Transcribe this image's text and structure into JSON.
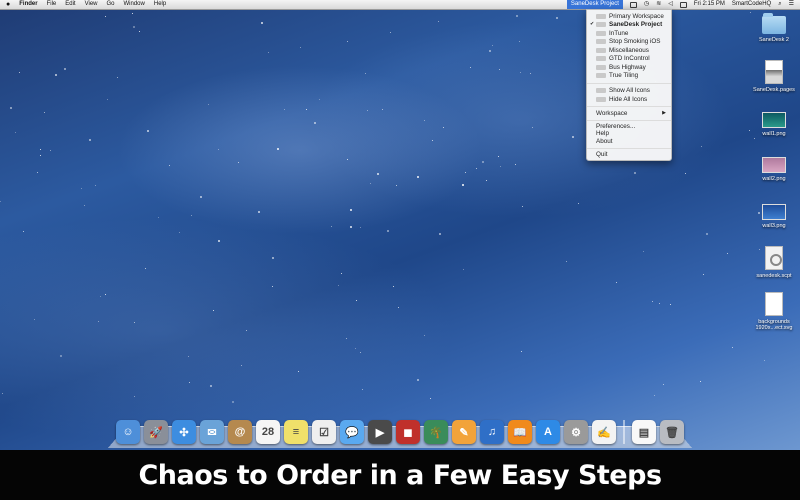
{
  "menubar": {
    "apple": "",
    "app_name": "Finder",
    "menus": [
      "File",
      "Edit",
      "View",
      "Go",
      "Window",
      "Help"
    ],
    "status_app": "SaneDesk Project",
    "clock": "Fri 2:15 PM",
    "user": "SmartCodeHQ"
  },
  "dropdown": {
    "workspaces": [
      "Primary Workspace",
      "SaneDesk Project",
      "InTune",
      "Stop Smoking iOS",
      "Miscellaneous",
      "GTD InControl",
      "Bus Highway",
      "True Tiling"
    ],
    "selected": "SaneDesk Project",
    "icon_actions": [
      "Show All Icons",
      "Hide All Icons"
    ],
    "workspace_submenu": "Workspace",
    "misc": [
      "Preferences...",
      "Help",
      "About"
    ],
    "quit": "Quit"
  },
  "desktop_icons": [
    {
      "label": "SaneDesk 2",
      "kind": "folder"
    },
    {
      "label": "SaneDesk.pages",
      "kind": "document"
    },
    {
      "label": "wall1.png",
      "kind": "image"
    },
    {
      "label": "wall2.png",
      "kind": "image"
    },
    {
      "label": "wall3.png",
      "kind": "image"
    },
    {
      "label": "sanedesk.scpt",
      "kind": "script"
    },
    {
      "label": "backgrounds 1920x...ect.svg",
      "kind": "document"
    }
  ],
  "dock_apps": [
    {
      "name": "finder-icon",
      "color": "#4e8fd9",
      "glyph": "☺"
    },
    {
      "name": "launchpad-icon",
      "color": "#8a8f99",
      "glyph": "🚀"
    },
    {
      "name": "safari-icon",
      "color": "#3d8de0",
      "glyph": "✣"
    },
    {
      "name": "mail-icon",
      "color": "#6aa3d8",
      "glyph": "✉"
    },
    {
      "name": "contacts-icon",
      "color": "#b5894f",
      "glyph": "@"
    },
    {
      "name": "calendar-icon",
      "color": "#f5f5f5",
      "glyph": "28"
    },
    {
      "name": "notes-icon",
      "color": "#f0e06a",
      "glyph": "≡"
    },
    {
      "name": "reminders-icon",
      "color": "#efefef",
      "glyph": "☑"
    },
    {
      "name": "messages-icon",
      "color": "#5aa9f0",
      "glyph": "💬"
    },
    {
      "name": "facetime-icon",
      "color": "#4a4a4a",
      "glyph": "▶"
    },
    {
      "name": "photo-booth-icon",
      "color": "#c0302b",
      "glyph": "◼"
    },
    {
      "name": "iphoto-icon",
      "color": "#3a8c5a",
      "glyph": "🌴"
    },
    {
      "name": "pages-icon",
      "color": "#f2a33a",
      "glyph": "✎"
    },
    {
      "name": "itunes-icon",
      "color": "#2f6fc7",
      "glyph": "♫"
    },
    {
      "name": "ibooks-icon",
      "color": "#f08a1c",
      "glyph": "📖"
    },
    {
      "name": "app-store-icon",
      "color": "#2e8ae6",
      "glyph": "A"
    },
    {
      "name": "system-preferences-icon",
      "color": "#9a9a9a",
      "glyph": "⚙"
    },
    {
      "name": "textedit-icon",
      "color": "#f3f3f3",
      "glyph": "✍"
    }
  ],
  "dock_right": [
    {
      "name": "documents-stack-icon",
      "color": "#f8f8f8",
      "glyph": "▤"
    },
    {
      "name": "trash-icon",
      "color": "#b9bcc2",
      "glyph": "🗑"
    }
  ],
  "caption": "Chaos to Order in a Few Easy Steps"
}
